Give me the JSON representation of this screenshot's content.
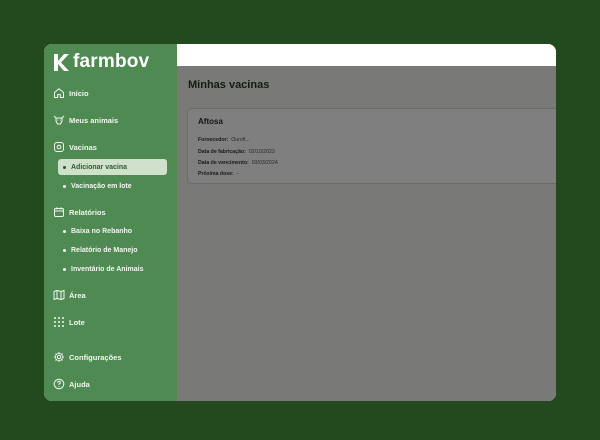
{
  "app": {
    "brand": "farmbov"
  },
  "sidebar": {
    "items": [
      {
        "label": "Início",
        "icon": "home-icon"
      },
      {
        "label": "Meus animais",
        "icon": "cow-icon"
      },
      {
        "label": "Vacinas",
        "icon": "vaccine-icon"
      },
      {
        "label": "Relatórios",
        "icon": "calendar-icon"
      },
      {
        "label": "Área",
        "icon": "map-icon"
      },
      {
        "label": "Lote",
        "icon": "grid-icon"
      },
      {
        "label": "Configurações",
        "icon": "gear-icon"
      },
      {
        "label": "Ajuda",
        "icon": "help-icon"
      }
    ],
    "vacinas_sub": [
      {
        "label": "Adicionar vacina",
        "active": true
      },
      {
        "label": "Vacinação em lote",
        "active": false
      }
    ],
    "relatorios_sub": [
      {
        "label": "Baixa no Rebanho"
      },
      {
        "label": "Relatório de Manejo"
      },
      {
        "label": "Inventário de Animais"
      }
    ]
  },
  "main": {
    "title": "Minhas vacinas",
    "card": {
      "title": "Aftosa",
      "fields": [
        {
          "key": "Fornecedor:",
          "value": "Ourofi..."
        },
        {
          "key": "Data de fabricação:",
          "value": "02/10/2023"
        },
        {
          "key": "Data de vencimento:",
          "value": "03/03/2024"
        },
        {
          "key": "Próxima dose:",
          "value": "-"
        }
      ]
    }
  },
  "colors": {
    "background": "#234a1e",
    "sidebar": "#4f8a53",
    "active_item": "#cfe0cb",
    "overlay": "rgba(0,0,0,0.5)"
  }
}
